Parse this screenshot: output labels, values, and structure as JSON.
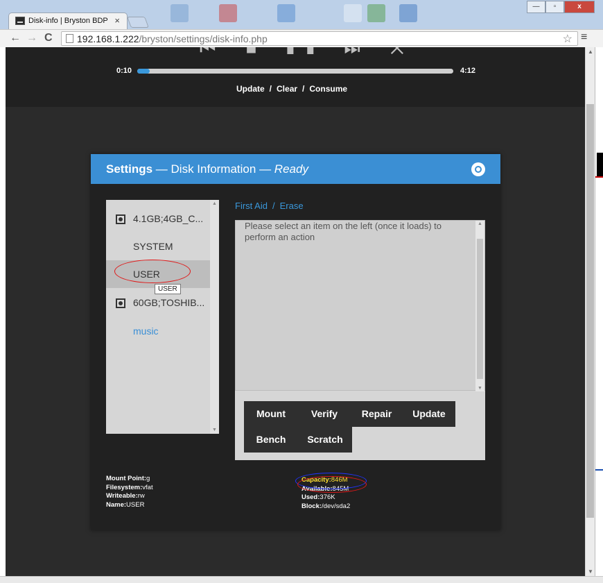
{
  "browser": {
    "tab_title": "Disk-info | Bryston BDP",
    "tab_close": "×",
    "url_host": "192.168.1.222",
    "url_path": "/bryston/settings/disk-info.php",
    "back": "←",
    "forward": "→",
    "reload": "C",
    "star": "☆",
    "menu": "≡",
    "minimize": "—",
    "maximize": "▫",
    "close": "x"
  },
  "player": {
    "controls": "⏮ ■ ❚❚ ⏭ ✕",
    "elapsed": "0:10",
    "total": "4:12",
    "progress_fraction": 0.035,
    "actions": [
      "Update",
      "Clear",
      "Consume"
    ],
    "separator": "/"
  },
  "modal": {
    "title_main": "Settings",
    "title_dash1": " — ",
    "title_section": "Disk Information",
    "title_dash2": " — ",
    "title_status": "Ready",
    "disks": [
      {
        "label": "4.1GB;4GB_C...",
        "icon": "disk-icon"
      },
      {
        "label": "SYSTEM"
      },
      {
        "label": "USER",
        "selected": true
      },
      {
        "label": "60GB;TOSHIB...",
        "icon": "disk-icon"
      },
      {
        "label": "music",
        "link": true
      }
    ],
    "tooltip": "USER",
    "action_links": [
      "First Aid",
      "Erase"
    ],
    "action_separator": "/",
    "output_text": "Please select an item on the left (once it loads) to perform an action",
    "buttons": [
      "Mount",
      "Verify",
      "Repair",
      "Update",
      "Bench",
      "Scratch"
    ],
    "info": {
      "mount_point_label": "Mount Point:",
      "mount_point": "g",
      "filesystem_label": "Filesystem:",
      "filesystem": "vfat",
      "writeable_label": "Writeable:",
      "writeable": "rw",
      "name_label": "Name:",
      "name": "USER"
    },
    "stats": {
      "capacity_label": "Capacity:",
      "capacity": "846M",
      "available_label": "Available:",
      "available": "845M",
      "used_label": "Used:",
      "used": "376K",
      "block_label": "Block:",
      "block": "/dev/sda2"
    }
  },
  "colors": {
    "accent": "#3b8fd4",
    "link": "#3a98db",
    "highlight": "#ffe033",
    "annotation_red": "#e01818",
    "annotation_blue": "#2233ff"
  }
}
